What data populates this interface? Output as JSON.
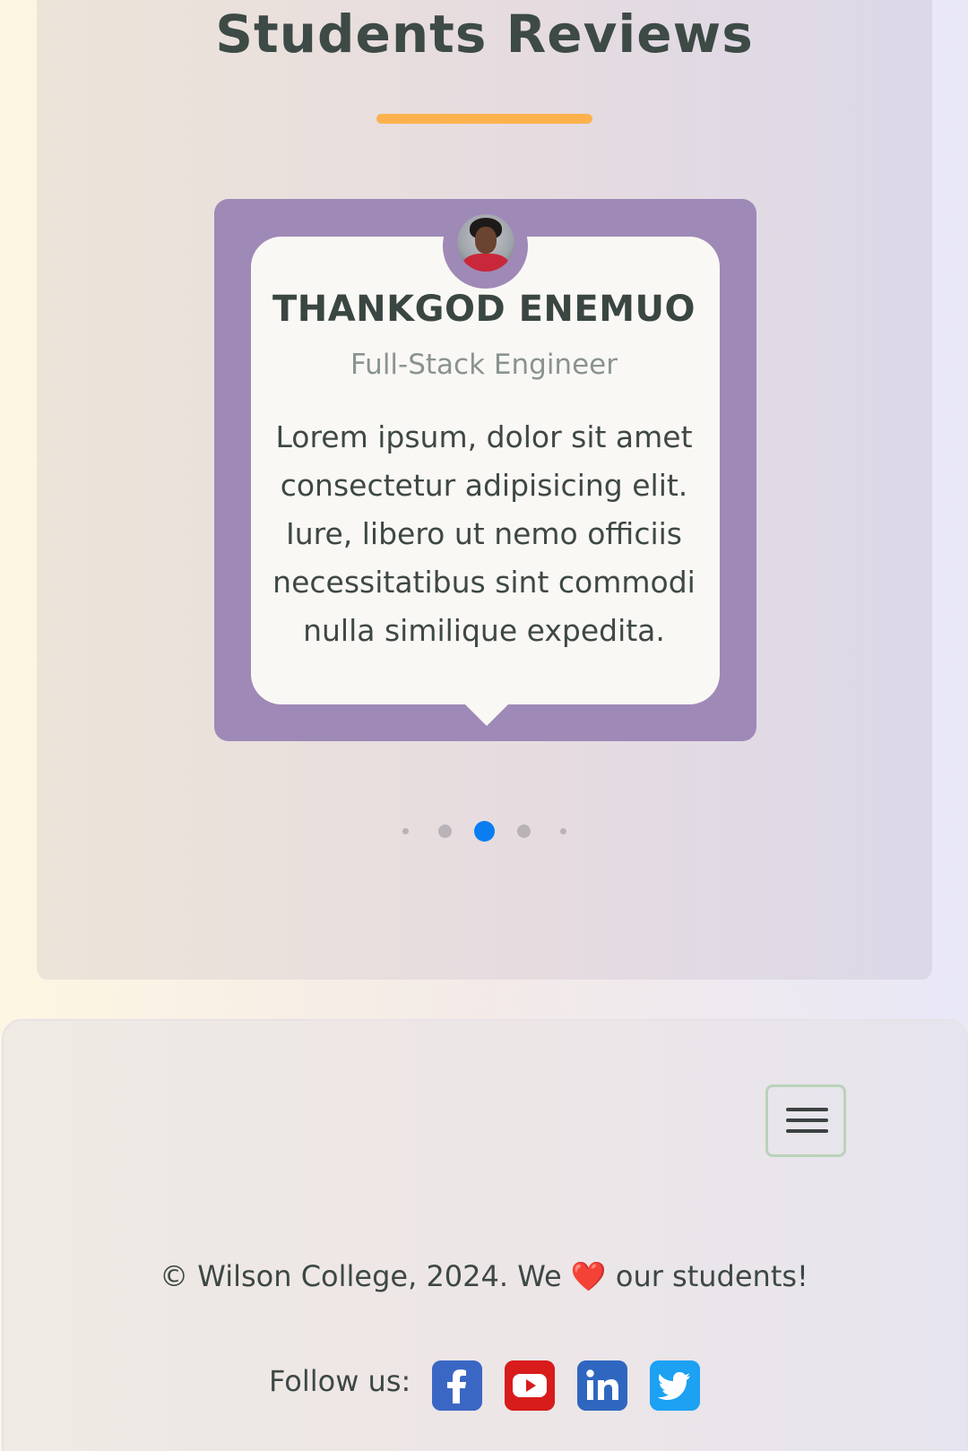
{
  "section": {
    "title": "Students Reviews",
    "accent_color": "#fbb24d"
  },
  "review": {
    "name": "THANKGOD ENEMUO",
    "role": "Full-Stack Engineer",
    "text": "Lorem ipsum, dolor sit amet consectetur adipisicing elit. Iure, libero ut nemo officiis necessitatibus sint commodi nulla similique expedita.",
    "card_color": "#9f89b7",
    "avatar_icon": "avatar-photo"
  },
  "carousel": {
    "total_dots": 5,
    "active_index": 2,
    "active_color": "#0a7df0"
  },
  "footer": {
    "menu_icon": "hamburger-menu-icon",
    "copyright_before": "© Wilson College, 2024. We",
    "heart": "❤️",
    "copyright_after": "our students!",
    "follow_label": "Follow us:",
    "social": [
      {
        "name": "facebook",
        "icon": "facebook-icon",
        "color": "#3b67c4"
      },
      {
        "name": "youtube",
        "icon": "youtube-icon",
        "color": "#e11d1d"
      },
      {
        "name": "linkedin",
        "icon": "linkedin-icon",
        "color": "#2f67c0"
      },
      {
        "name": "twitter",
        "icon": "twitter-icon",
        "color": "#1da1f2"
      }
    ]
  }
}
